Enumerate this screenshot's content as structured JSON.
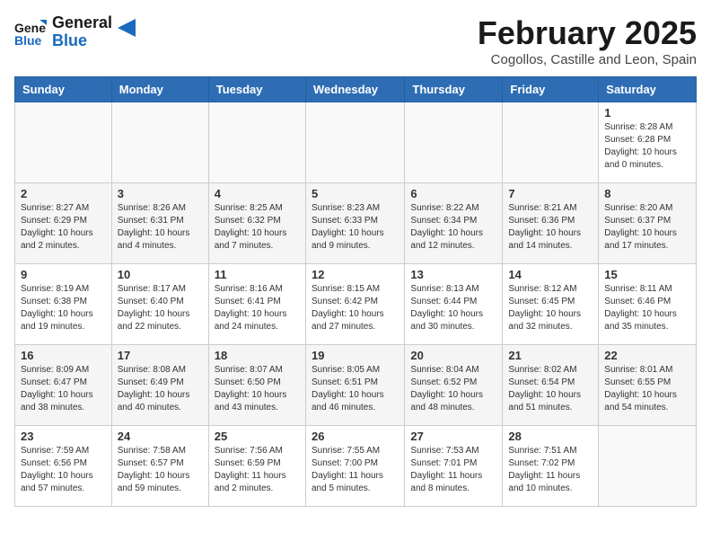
{
  "logo": {
    "general": "General",
    "blue": "Blue"
  },
  "header": {
    "title": "February 2025",
    "subtitle": "Cogollos, Castille and Leon, Spain"
  },
  "weekdays": [
    "Sunday",
    "Monday",
    "Tuesday",
    "Wednesday",
    "Thursday",
    "Friday",
    "Saturday"
  ],
  "weeks": [
    [
      {
        "day": "",
        "info": ""
      },
      {
        "day": "",
        "info": ""
      },
      {
        "day": "",
        "info": ""
      },
      {
        "day": "",
        "info": ""
      },
      {
        "day": "",
        "info": ""
      },
      {
        "day": "",
        "info": ""
      },
      {
        "day": "1",
        "info": "Sunrise: 8:28 AM\nSunset: 6:28 PM\nDaylight: 10 hours and 0 minutes."
      }
    ],
    [
      {
        "day": "2",
        "info": "Sunrise: 8:27 AM\nSunset: 6:29 PM\nDaylight: 10 hours and 2 minutes."
      },
      {
        "day": "3",
        "info": "Sunrise: 8:26 AM\nSunset: 6:31 PM\nDaylight: 10 hours and 4 minutes."
      },
      {
        "day": "4",
        "info": "Sunrise: 8:25 AM\nSunset: 6:32 PM\nDaylight: 10 hours and 7 minutes."
      },
      {
        "day": "5",
        "info": "Sunrise: 8:23 AM\nSunset: 6:33 PM\nDaylight: 10 hours and 9 minutes."
      },
      {
        "day": "6",
        "info": "Sunrise: 8:22 AM\nSunset: 6:34 PM\nDaylight: 10 hours and 12 minutes."
      },
      {
        "day": "7",
        "info": "Sunrise: 8:21 AM\nSunset: 6:36 PM\nDaylight: 10 hours and 14 minutes."
      },
      {
        "day": "8",
        "info": "Sunrise: 8:20 AM\nSunset: 6:37 PM\nDaylight: 10 hours and 17 minutes."
      }
    ],
    [
      {
        "day": "9",
        "info": "Sunrise: 8:19 AM\nSunset: 6:38 PM\nDaylight: 10 hours and 19 minutes."
      },
      {
        "day": "10",
        "info": "Sunrise: 8:17 AM\nSunset: 6:40 PM\nDaylight: 10 hours and 22 minutes."
      },
      {
        "day": "11",
        "info": "Sunrise: 8:16 AM\nSunset: 6:41 PM\nDaylight: 10 hours and 24 minutes."
      },
      {
        "day": "12",
        "info": "Sunrise: 8:15 AM\nSunset: 6:42 PM\nDaylight: 10 hours and 27 minutes."
      },
      {
        "day": "13",
        "info": "Sunrise: 8:13 AM\nSunset: 6:44 PM\nDaylight: 10 hours and 30 minutes."
      },
      {
        "day": "14",
        "info": "Sunrise: 8:12 AM\nSunset: 6:45 PM\nDaylight: 10 hours and 32 minutes."
      },
      {
        "day": "15",
        "info": "Sunrise: 8:11 AM\nSunset: 6:46 PM\nDaylight: 10 hours and 35 minutes."
      }
    ],
    [
      {
        "day": "16",
        "info": "Sunrise: 8:09 AM\nSunset: 6:47 PM\nDaylight: 10 hours and 38 minutes."
      },
      {
        "day": "17",
        "info": "Sunrise: 8:08 AM\nSunset: 6:49 PM\nDaylight: 10 hours and 40 minutes."
      },
      {
        "day": "18",
        "info": "Sunrise: 8:07 AM\nSunset: 6:50 PM\nDaylight: 10 hours and 43 minutes."
      },
      {
        "day": "19",
        "info": "Sunrise: 8:05 AM\nSunset: 6:51 PM\nDaylight: 10 hours and 46 minutes."
      },
      {
        "day": "20",
        "info": "Sunrise: 8:04 AM\nSunset: 6:52 PM\nDaylight: 10 hours and 48 minutes."
      },
      {
        "day": "21",
        "info": "Sunrise: 8:02 AM\nSunset: 6:54 PM\nDaylight: 10 hours and 51 minutes."
      },
      {
        "day": "22",
        "info": "Sunrise: 8:01 AM\nSunset: 6:55 PM\nDaylight: 10 hours and 54 minutes."
      }
    ],
    [
      {
        "day": "23",
        "info": "Sunrise: 7:59 AM\nSunset: 6:56 PM\nDaylight: 10 hours and 57 minutes."
      },
      {
        "day": "24",
        "info": "Sunrise: 7:58 AM\nSunset: 6:57 PM\nDaylight: 10 hours and 59 minutes."
      },
      {
        "day": "25",
        "info": "Sunrise: 7:56 AM\nSunset: 6:59 PM\nDaylight: 11 hours and 2 minutes."
      },
      {
        "day": "26",
        "info": "Sunrise: 7:55 AM\nSunset: 7:00 PM\nDaylight: 11 hours and 5 minutes."
      },
      {
        "day": "27",
        "info": "Sunrise: 7:53 AM\nSunset: 7:01 PM\nDaylight: 11 hours and 8 minutes."
      },
      {
        "day": "28",
        "info": "Sunrise: 7:51 AM\nSunset: 7:02 PM\nDaylight: 11 hours and 10 minutes."
      },
      {
        "day": "",
        "info": ""
      }
    ]
  ]
}
